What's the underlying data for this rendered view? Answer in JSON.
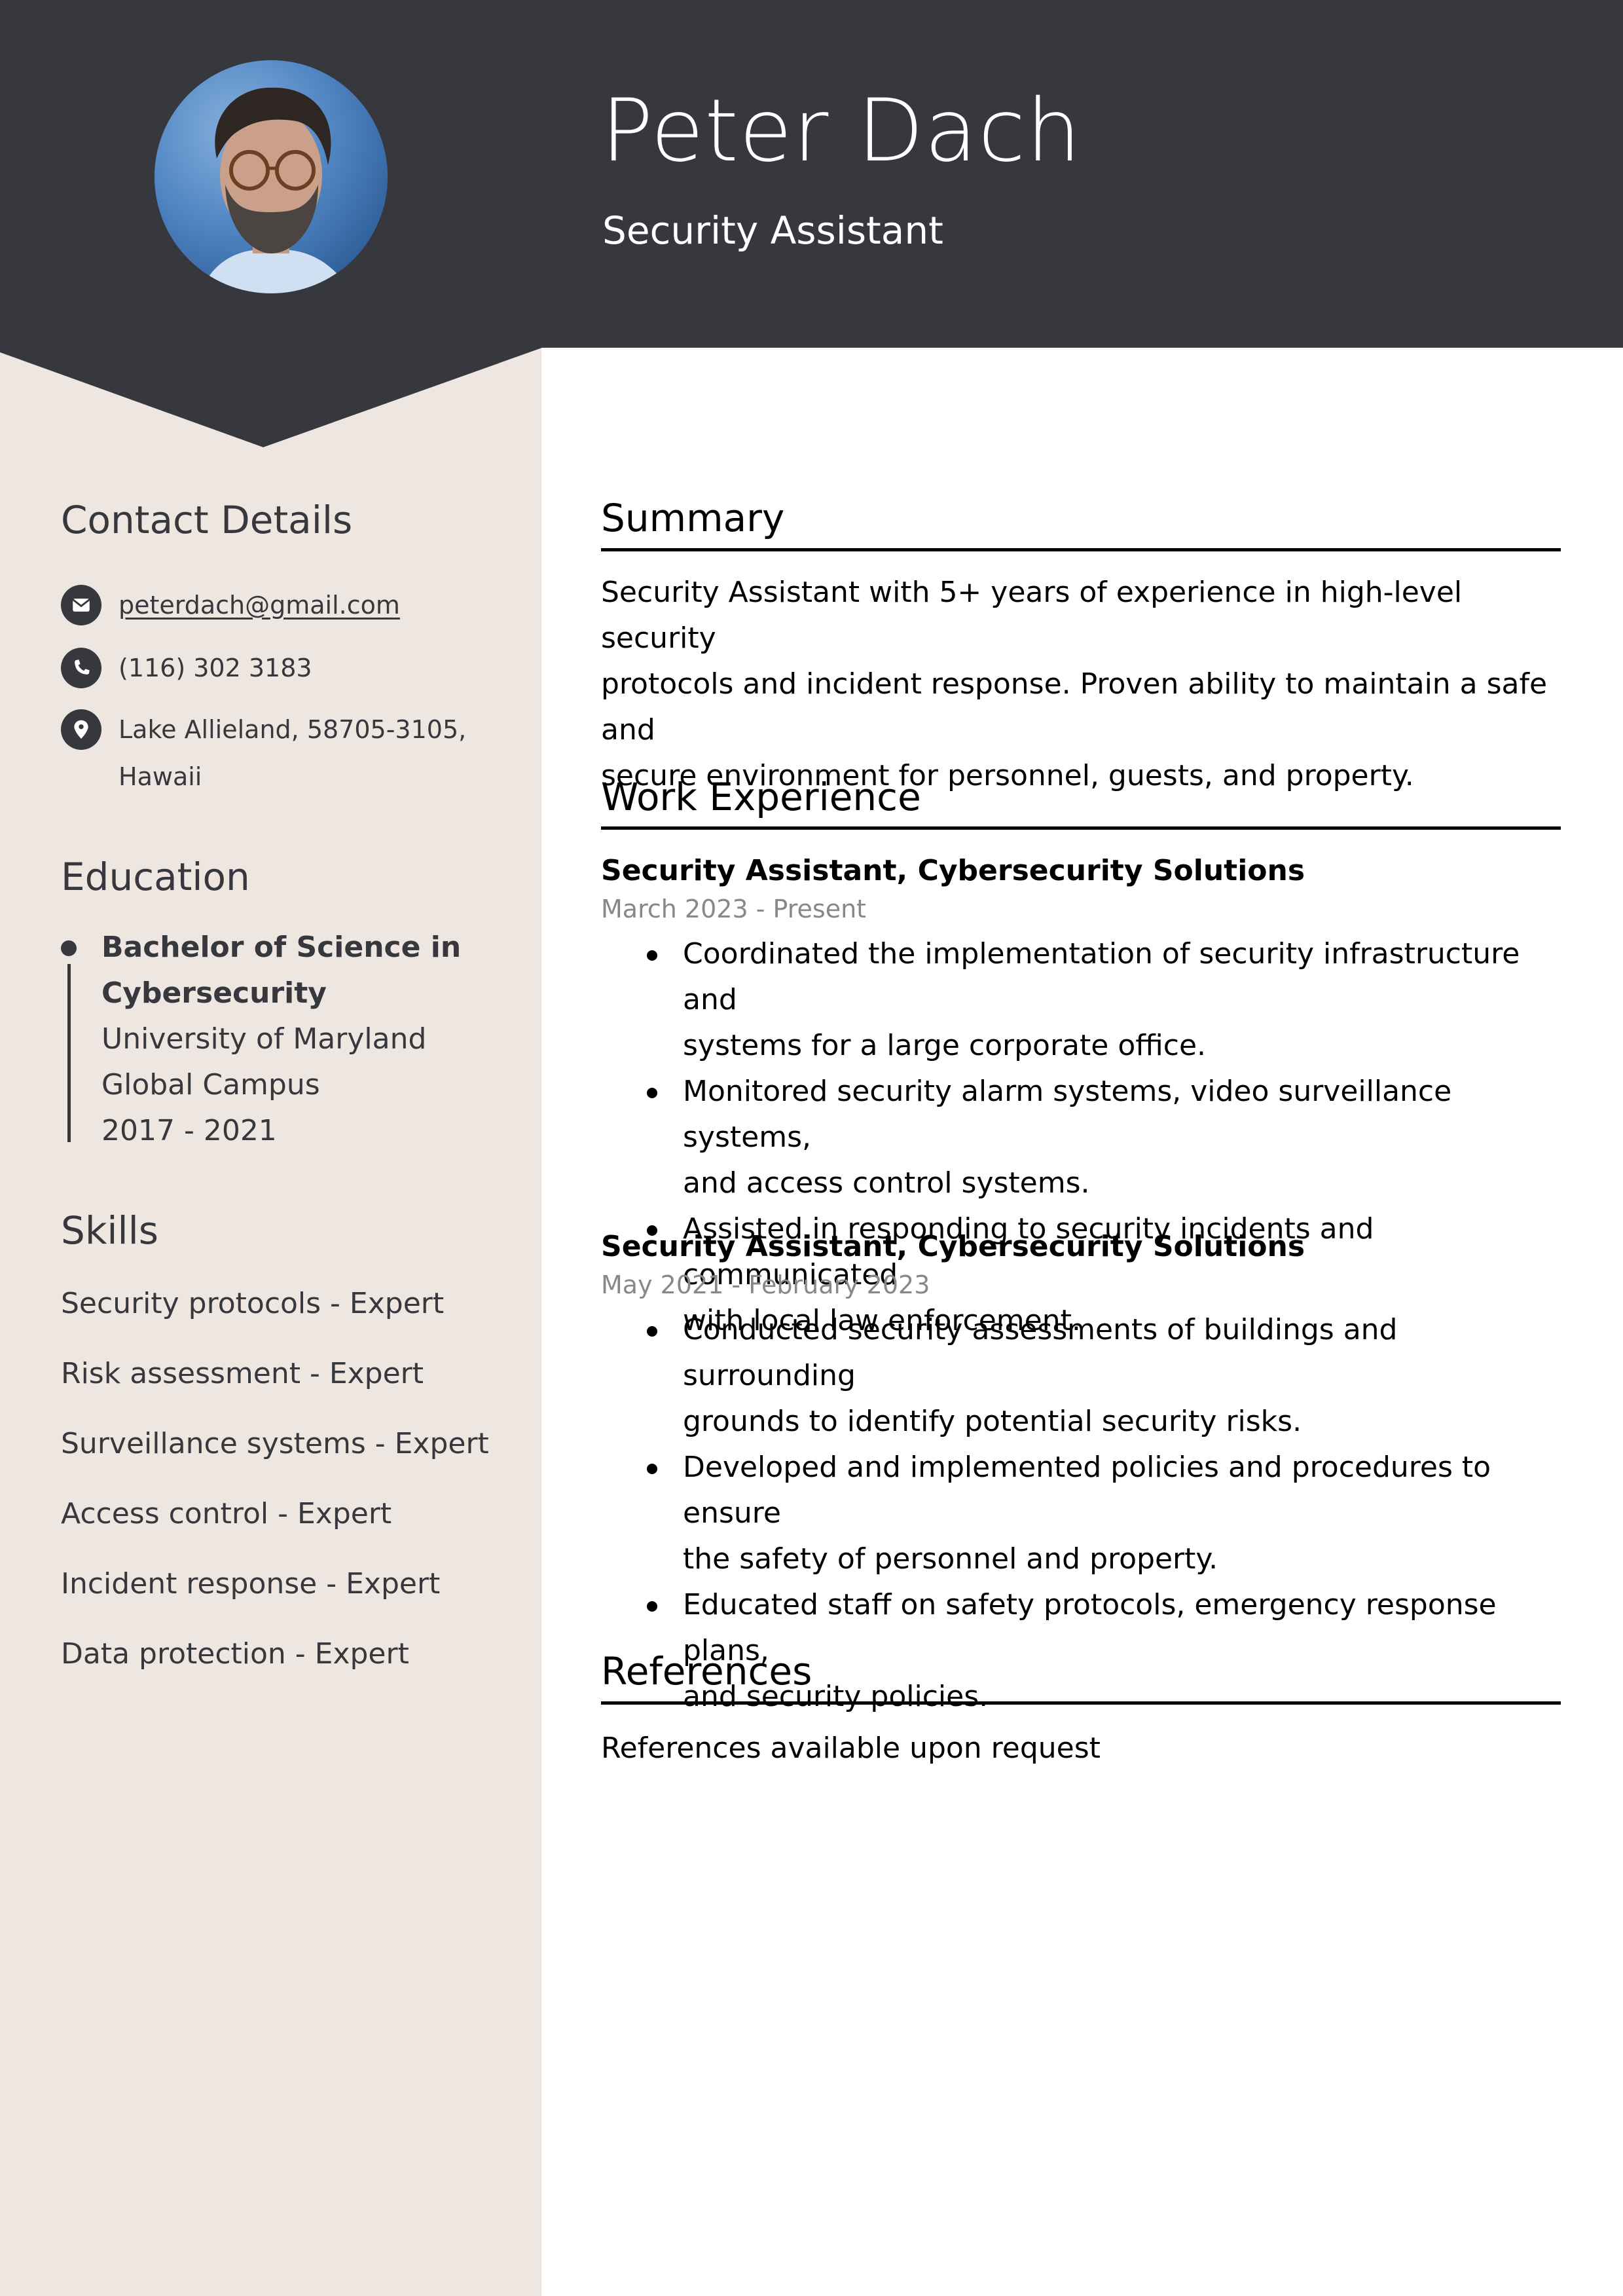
{
  "header": {
    "name": "Peter Dach",
    "title": "Security Assistant",
    "photo_alt": "Profile photo of Peter Dach"
  },
  "colors": {
    "header_bg": "#37383e",
    "sidebar_bg": "#ede6e1",
    "muted_text": "#888888"
  },
  "sidebar": {
    "contact": {
      "heading": "Contact Details",
      "items": [
        {
          "icon": "envelope-icon",
          "text": "peterdach@gmail.com",
          "is_link": true
        },
        {
          "icon": "phone-icon",
          "text": "(116) 302 3183",
          "is_link": false
        },
        {
          "icon": "location-pin-icon",
          "text_line1": "Lake Allieland, 58705-3105,",
          "text_line2": "Hawaii",
          "is_link": false
        }
      ]
    },
    "education": {
      "heading": "Education",
      "entries": [
        {
          "degree_line1": "Bachelor of Science in",
          "degree_line2": "Cybersecurity",
          "school_line1": "University of Maryland",
          "school_line2": "Global Campus",
          "years": "2017 - 2021"
        }
      ]
    },
    "skills": {
      "heading": "Skills",
      "items": [
        "Security protocols - Expert",
        "Risk assessment - Expert",
        "Surveillance systems - Expert",
        "Access control - Expert",
        "Incident response - Expert",
        "Data protection - Expert"
      ]
    }
  },
  "main": {
    "summary": {
      "heading": "Summary",
      "lines": [
        "Security Assistant with 5+ years of experience in high-level security",
        "protocols and incident response. Proven ability to maintain a safe and",
        "secure environment for personnel, guests, and property."
      ]
    },
    "work": {
      "heading": "Work Experience",
      "jobs": [
        {
          "title": "Security Assistant, Cybersecurity Solutions",
          "dates": "March 2023 - Present",
          "bullets": [
            [
              "Coordinated the implementation of security infrastructure and",
              "systems for a large corporate office."
            ],
            [
              "Monitored security alarm systems, video surveillance systems,",
              "and access control systems."
            ],
            [
              "Assisted in responding to security incidents and communicated",
              "with local law enforcement."
            ]
          ]
        },
        {
          "title": "Security Assistant, Cybersecurity Solutions",
          "dates": "May 2021 - February 2023",
          "bullets": [
            [
              "Conducted security assessments of buildings and surrounding",
              "grounds to identify potential security risks."
            ],
            [
              "Developed and implemented policies and procedures to ensure",
              "the safety of personnel and property."
            ],
            [
              "Educated staff on safety protocols, emergency response plans,",
              "and security policies."
            ]
          ]
        }
      ]
    },
    "references": {
      "heading": "References",
      "text": "References available upon request"
    }
  }
}
